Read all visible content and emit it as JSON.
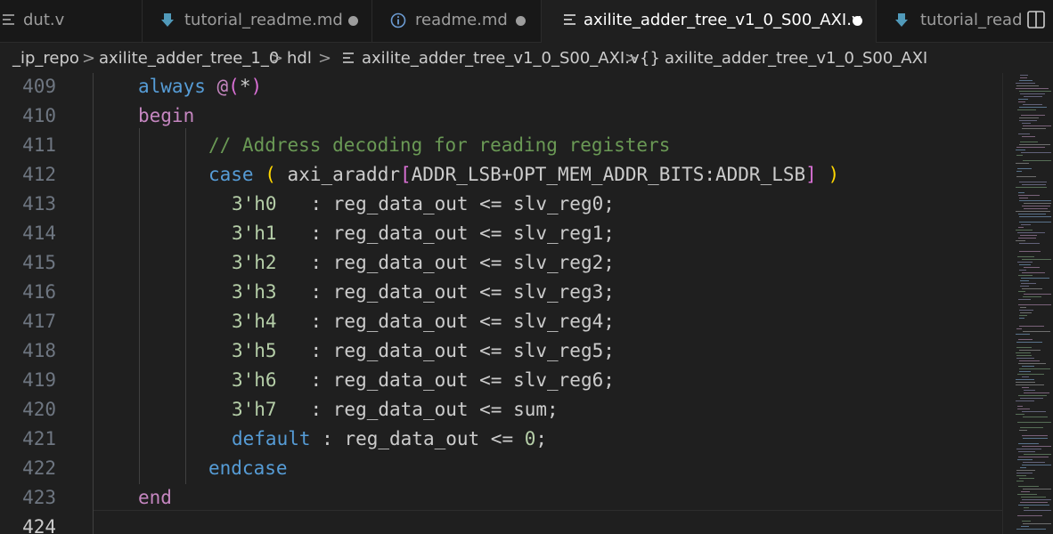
{
  "tabs": [
    {
      "label": "dut.v",
      "icon": "lines-icon",
      "dirty": false,
      "active": false
    },
    {
      "label": "tutorial_readme.md",
      "icon": "markdown-arrow-icon",
      "dirty": true,
      "active": false
    },
    {
      "label": "readme.md",
      "icon": "info-icon",
      "dirty": true,
      "active": false
    },
    {
      "label": "axilite_adder_tree_v1_0_S00_AXI.v",
      "icon": "lines-icon",
      "dirty": true,
      "active": true
    },
    {
      "label": "tutorial_read",
      "icon": "markdown-arrow-icon",
      "dirty": false,
      "active": false
    }
  ],
  "breadcrumb": {
    "items": [
      "_ip_repo",
      "axilite_adder_tree_1_0",
      "hdl",
      "axilite_adder_tree_v1_0_S00_AXI.v",
      "axilite_adder_tree_v1_0_S00_AXI"
    ],
    "separator": ">",
    "module_icon": "{}"
  },
  "editor": {
    "line_numbers": [
      "409",
      "410",
      "411",
      "412",
      "413",
      "414",
      "415",
      "416",
      "417",
      "418",
      "419",
      "420",
      "421",
      "422",
      "423",
      "424"
    ],
    "current_line": "424",
    "lines": {
      "l409": {
        "kw": "always",
        "sp": " ",
        "at": "@",
        "lp": "(",
        "star": "*",
        "rp": ")"
      },
      "l410": {
        "kw": "begin"
      },
      "l411": {
        "comment": "// Address decoding for reading registers"
      },
      "l412": {
        "kw": "case",
        "sp1": " ",
        "lp": "(",
        "sp2": " ",
        "id": "axi_araddr",
        "lb": "[",
        "expr": "ADDR_LSB+OPT_MEM_ADDR_BITS:ADDR_LSB",
        "rb": "]",
        "sp3": " ",
        "rp": ")"
      },
      "cases": [
        {
          "val": "3'h0",
          "rest": "   : reg_data_out <= slv_reg0;"
        },
        {
          "val": "3'h1",
          "rest": "   : reg_data_out <= slv_reg1;"
        },
        {
          "val": "3'h2",
          "rest": "   : reg_data_out <= slv_reg2;"
        },
        {
          "val": "3'h3",
          "rest": "   : reg_data_out <= slv_reg3;"
        },
        {
          "val": "3'h4",
          "rest": "   : reg_data_out <= slv_reg4;"
        },
        {
          "val": "3'h5",
          "rest": "   : reg_data_out <= slv_reg5;"
        },
        {
          "val": "3'h6",
          "rest": "   : reg_data_out <= slv_reg6;"
        },
        {
          "val": "3'h7",
          "rest": "   : reg_data_out <= sum;"
        }
      ],
      "l421": {
        "kw": "default",
        "mid": " : reg_data_out <= ",
        "num": "0",
        "end": ";"
      },
      "l422": {
        "kw": "endcase"
      },
      "l423": {
        "kw": "end"
      }
    }
  },
  "colors": {
    "keyword_purple": "#c586c0",
    "keyword_blue": "#569cd6",
    "comment": "#6a9955",
    "number": "#b5cea8",
    "bracket_yellow": "#ffd700",
    "bracket_purple": "#da70d6",
    "editor_bg": "#1f1f1f",
    "tabbar_bg": "#181818"
  }
}
